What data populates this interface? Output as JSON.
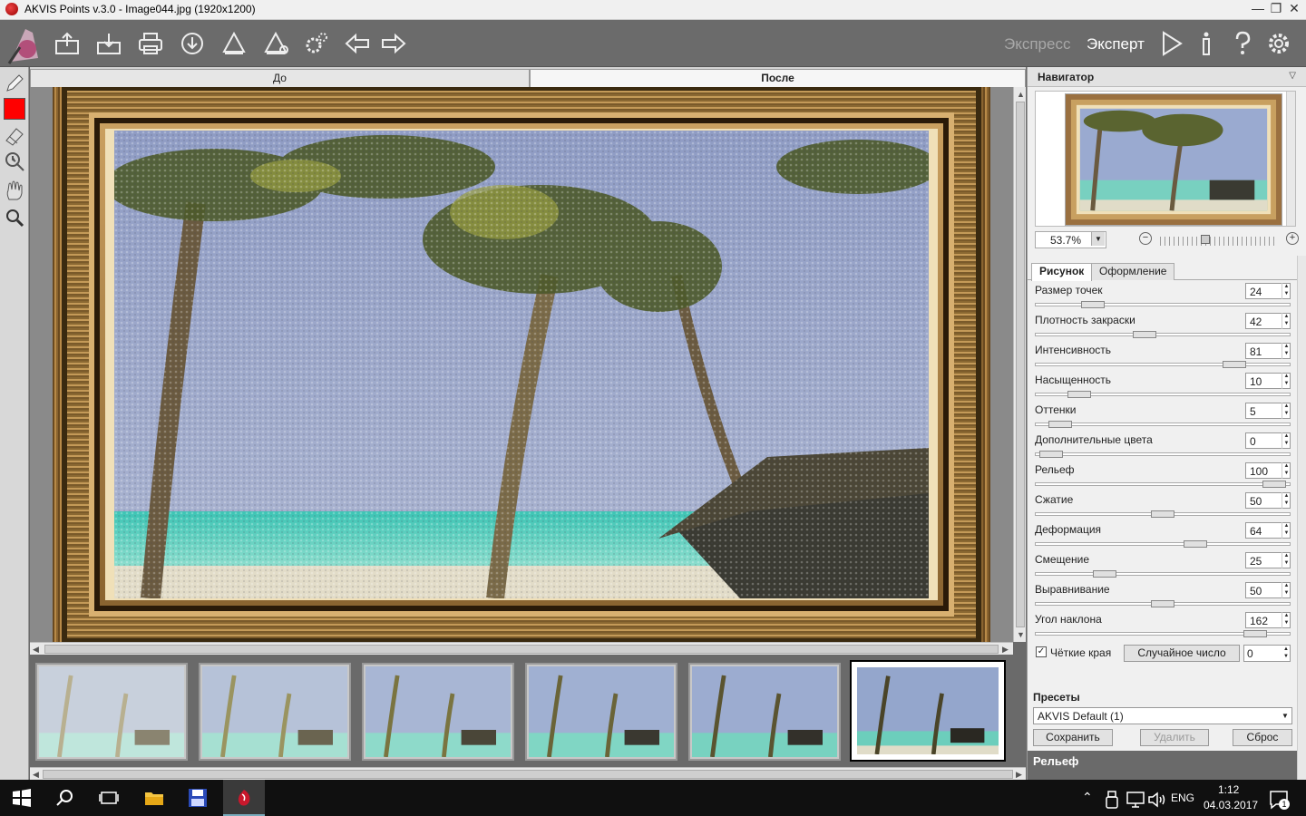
{
  "window": {
    "title": "AKVIS Points v.3.0 - Image044.jpg (1920x1200)",
    "minimize": "—",
    "maximize": "❐",
    "close": "✕"
  },
  "toolbar": {
    "modes": {
      "express": "Экспресс",
      "expert": "Эксперт"
    }
  },
  "view_tabs": {
    "before": "До",
    "after": "После"
  },
  "navigator": {
    "title": "Навигатор",
    "zoom": "53.7%"
  },
  "panel": {
    "tabs": {
      "drawing": "Рисунок",
      "decoration": "Оформление"
    },
    "params": [
      {
        "label": "Размер точек",
        "value": "24",
        "fraction": 0.2
      },
      {
        "label": "Плотность закраски",
        "value": "42",
        "fraction": 0.42
      },
      {
        "label": "Интенсивность",
        "value": "81",
        "fraction": 0.81
      },
      {
        "label": "Насыщенность",
        "value": "10",
        "fraction": 0.14
      },
      {
        "label": "Оттенки",
        "value": "5",
        "fraction": 0.06
      },
      {
        "label": "Дополнительные цвета",
        "value": "0",
        "fraction": 0.02
      },
      {
        "label": "Рельеф",
        "value": "100",
        "fraction": 0.98
      },
      {
        "label": "Сжатие",
        "value": "50",
        "fraction": 0.5
      },
      {
        "label": "Деформация",
        "value": "64",
        "fraction": 0.64
      },
      {
        "label": "Смещение",
        "value": "25",
        "fraction": 0.25
      },
      {
        "label": "Выравнивание",
        "value": "50",
        "fraction": 0.5
      },
      {
        "label": "Угол наклона",
        "value": "162",
        "fraction": 0.9
      }
    ],
    "sharp_edges": {
      "label": "Чёткие края",
      "checked": true
    },
    "random_button": "Случайное число",
    "random_value": "0"
  },
  "presets": {
    "title": "Пресеты",
    "selected": "AKVIS Default (1)",
    "save": "Сохранить",
    "delete": "Удалить",
    "reset": "Сброс"
  },
  "hint": "Рельеф",
  "taskbar": {
    "lang": "ENG",
    "time": "1:12",
    "date": "04.03.2017",
    "notifications": "1"
  },
  "colors": {
    "foreground": "#ff0000",
    "app_dark": "#6b6b6b",
    "panel": "#f0f0f0"
  }
}
